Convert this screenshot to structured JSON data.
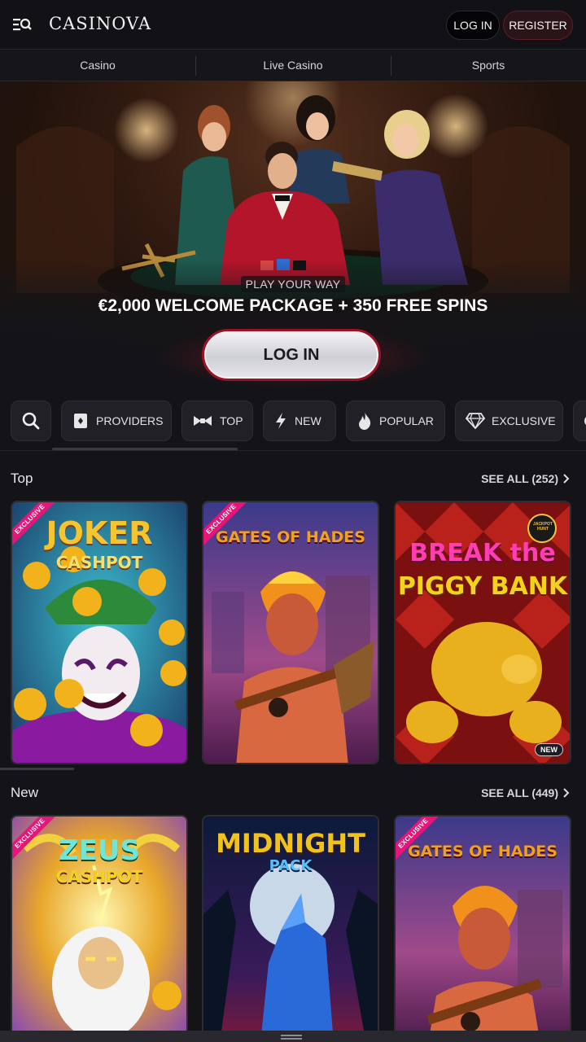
{
  "header": {
    "logo": "CASINOVA",
    "login_label": "LOG IN",
    "register_label": "REGISTER"
  },
  "nav": {
    "tabs": [
      "Casino",
      "Live Casino",
      "Sports"
    ]
  },
  "hero": {
    "kicker": "PLAY YOUR WAY",
    "headline": "€2,000 WELCOME PACKAGE + 350 FREE SPINS",
    "cta_label": "LOG IN"
  },
  "filters": {
    "chips": [
      {
        "label": "PROVIDERS",
        "icon": "providers-icon"
      },
      {
        "label": "TOP",
        "icon": "bowtie-icon"
      },
      {
        "label": "NEW",
        "icon": "lightning-icon"
      },
      {
        "label": "POPULAR",
        "icon": "flame-icon"
      },
      {
        "label": "EXCLUSIVE",
        "icon": "diamond-icon"
      }
    ],
    "search_icon": "search-icon"
  },
  "sections": {
    "top": {
      "title": "Top",
      "see_all": "SEE ALL (252)",
      "games": [
        {
          "title_line1": "JOKER",
          "title_line2": "CASHPOT",
          "badge": "EXCLUSIVE"
        },
        {
          "title_line1": "GATES OF HADES",
          "badge": "EXCLUSIVE"
        },
        {
          "title_line1": "BREAK the",
          "title_line2": "PIGGY BANK",
          "corner_badge": "JACKPOT HUNT",
          "status": "NEW"
        }
      ]
    },
    "new": {
      "title": "New",
      "see_all": "SEE ALL (449)",
      "games": [
        {
          "title_line1": "ZEUS",
          "title_line2": "CASHPOT",
          "badge": "EXCLUSIVE"
        },
        {
          "title_line1": "MIDNIGHT",
          "title_line2": "PACK"
        },
        {
          "title_line1": "GATES OF HADES",
          "badge": "EXCLUSIVE"
        }
      ]
    }
  },
  "colors": {
    "background": "#141418",
    "accent_red": "#9b1125",
    "exclusive_pink": "#e5157a"
  }
}
